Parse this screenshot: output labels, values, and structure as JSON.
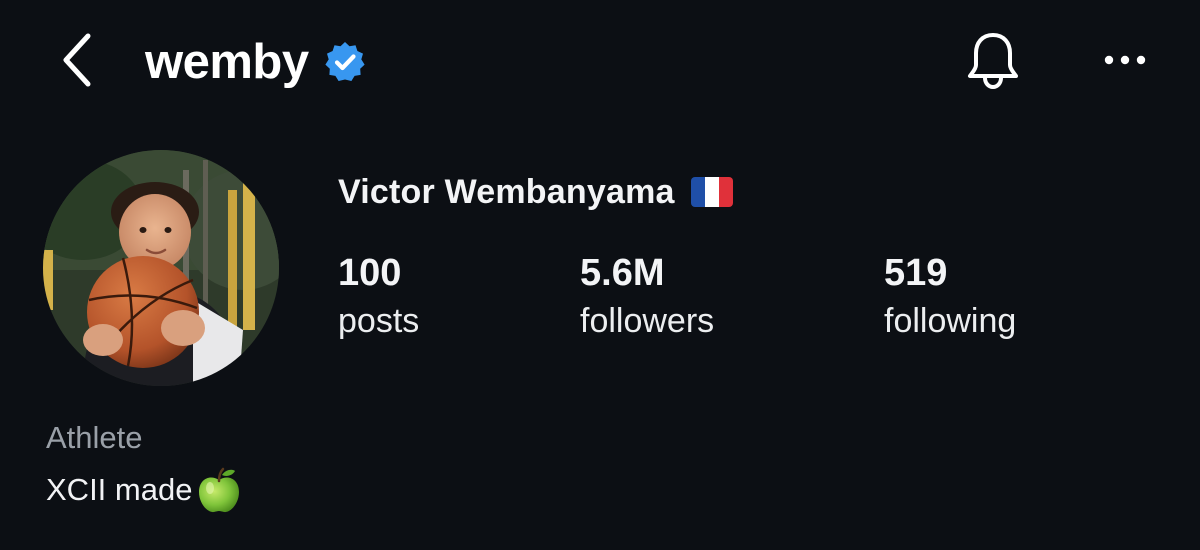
{
  "header": {
    "username": "wemby",
    "verified": true,
    "icons": {
      "back": "chevron-left-icon",
      "verified": "verified-badge-icon",
      "notifications": "bell-icon",
      "more": "more-dots-icon"
    }
  },
  "profile": {
    "full_name": "Victor Wembanyama",
    "flag": "france-flag",
    "avatar": "profile-photo-child-holding-basketball",
    "stats": [
      {
        "value": "100",
        "label": "posts"
      },
      {
        "value": "5.6M",
        "label": "followers"
      },
      {
        "value": "519",
        "label": "following"
      }
    ],
    "category": "Athlete",
    "bio": "XCII made",
    "bio_emoji": "green-apple"
  },
  "colors": {
    "background": "#0c0f14",
    "verified_blue": "#3897f0",
    "text_primary": "#f3f4f6",
    "text_secondary": "#9aa0a8",
    "flag_blue": "#1f4fa8",
    "flag_white": "#ffffff",
    "flag_red": "#e0313a"
  }
}
